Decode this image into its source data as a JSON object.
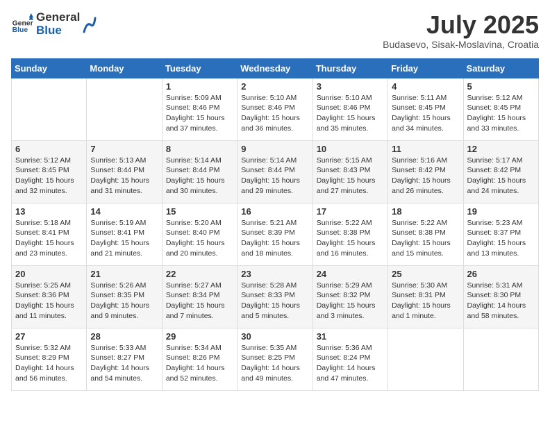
{
  "header": {
    "logo_general": "General",
    "logo_blue": "Blue",
    "month_year": "July 2025",
    "location": "Budasevo, Sisak-Moslavina, Croatia"
  },
  "weekdays": [
    "Sunday",
    "Monday",
    "Tuesday",
    "Wednesday",
    "Thursday",
    "Friday",
    "Saturday"
  ],
  "weeks": [
    [
      {
        "day": "",
        "sunrise": "",
        "sunset": "",
        "daylight": ""
      },
      {
        "day": "",
        "sunrise": "",
        "sunset": "",
        "daylight": ""
      },
      {
        "day": "1",
        "sunrise": "Sunrise: 5:09 AM",
        "sunset": "Sunset: 8:46 PM",
        "daylight": "Daylight: 15 hours and 37 minutes."
      },
      {
        "day": "2",
        "sunrise": "Sunrise: 5:10 AM",
        "sunset": "Sunset: 8:46 PM",
        "daylight": "Daylight: 15 hours and 36 minutes."
      },
      {
        "day": "3",
        "sunrise": "Sunrise: 5:10 AM",
        "sunset": "Sunset: 8:46 PM",
        "daylight": "Daylight: 15 hours and 35 minutes."
      },
      {
        "day": "4",
        "sunrise": "Sunrise: 5:11 AM",
        "sunset": "Sunset: 8:45 PM",
        "daylight": "Daylight: 15 hours and 34 minutes."
      },
      {
        "day": "5",
        "sunrise": "Sunrise: 5:12 AM",
        "sunset": "Sunset: 8:45 PM",
        "daylight": "Daylight: 15 hours and 33 minutes."
      }
    ],
    [
      {
        "day": "6",
        "sunrise": "Sunrise: 5:12 AM",
        "sunset": "Sunset: 8:45 PM",
        "daylight": "Daylight: 15 hours and 32 minutes."
      },
      {
        "day": "7",
        "sunrise": "Sunrise: 5:13 AM",
        "sunset": "Sunset: 8:44 PM",
        "daylight": "Daylight: 15 hours and 31 minutes."
      },
      {
        "day": "8",
        "sunrise": "Sunrise: 5:14 AM",
        "sunset": "Sunset: 8:44 PM",
        "daylight": "Daylight: 15 hours and 30 minutes."
      },
      {
        "day": "9",
        "sunrise": "Sunrise: 5:14 AM",
        "sunset": "Sunset: 8:44 PM",
        "daylight": "Daylight: 15 hours and 29 minutes."
      },
      {
        "day": "10",
        "sunrise": "Sunrise: 5:15 AM",
        "sunset": "Sunset: 8:43 PM",
        "daylight": "Daylight: 15 hours and 27 minutes."
      },
      {
        "day": "11",
        "sunrise": "Sunrise: 5:16 AM",
        "sunset": "Sunset: 8:42 PM",
        "daylight": "Daylight: 15 hours and 26 minutes."
      },
      {
        "day": "12",
        "sunrise": "Sunrise: 5:17 AM",
        "sunset": "Sunset: 8:42 PM",
        "daylight": "Daylight: 15 hours and 24 minutes."
      }
    ],
    [
      {
        "day": "13",
        "sunrise": "Sunrise: 5:18 AM",
        "sunset": "Sunset: 8:41 PM",
        "daylight": "Daylight: 15 hours and 23 minutes."
      },
      {
        "day": "14",
        "sunrise": "Sunrise: 5:19 AM",
        "sunset": "Sunset: 8:41 PM",
        "daylight": "Daylight: 15 hours and 21 minutes."
      },
      {
        "day": "15",
        "sunrise": "Sunrise: 5:20 AM",
        "sunset": "Sunset: 8:40 PM",
        "daylight": "Daylight: 15 hours and 20 minutes."
      },
      {
        "day": "16",
        "sunrise": "Sunrise: 5:21 AM",
        "sunset": "Sunset: 8:39 PM",
        "daylight": "Daylight: 15 hours and 18 minutes."
      },
      {
        "day": "17",
        "sunrise": "Sunrise: 5:22 AM",
        "sunset": "Sunset: 8:38 PM",
        "daylight": "Daylight: 15 hours and 16 minutes."
      },
      {
        "day": "18",
        "sunrise": "Sunrise: 5:22 AM",
        "sunset": "Sunset: 8:38 PM",
        "daylight": "Daylight: 15 hours and 15 minutes."
      },
      {
        "day": "19",
        "sunrise": "Sunrise: 5:23 AM",
        "sunset": "Sunset: 8:37 PM",
        "daylight": "Daylight: 15 hours and 13 minutes."
      }
    ],
    [
      {
        "day": "20",
        "sunrise": "Sunrise: 5:25 AM",
        "sunset": "Sunset: 8:36 PM",
        "daylight": "Daylight: 15 hours and 11 minutes."
      },
      {
        "day": "21",
        "sunrise": "Sunrise: 5:26 AM",
        "sunset": "Sunset: 8:35 PM",
        "daylight": "Daylight: 15 hours and 9 minutes."
      },
      {
        "day": "22",
        "sunrise": "Sunrise: 5:27 AM",
        "sunset": "Sunset: 8:34 PM",
        "daylight": "Daylight: 15 hours and 7 minutes."
      },
      {
        "day": "23",
        "sunrise": "Sunrise: 5:28 AM",
        "sunset": "Sunset: 8:33 PM",
        "daylight": "Daylight: 15 hours and 5 minutes."
      },
      {
        "day": "24",
        "sunrise": "Sunrise: 5:29 AM",
        "sunset": "Sunset: 8:32 PM",
        "daylight": "Daylight: 15 hours and 3 minutes."
      },
      {
        "day": "25",
        "sunrise": "Sunrise: 5:30 AM",
        "sunset": "Sunset: 8:31 PM",
        "daylight": "Daylight: 15 hours and 1 minute."
      },
      {
        "day": "26",
        "sunrise": "Sunrise: 5:31 AM",
        "sunset": "Sunset: 8:30 PM",
        "daylight": "Daylight: 14 hours and 58 minutes."
      }
    ],
    [
      {
        "day": "27",
        "sunrise": "Sunrise: 5:32 AM",
        "sunset": "Sunset: 8:29 PM",
        "daylight": "Daylight: 14 hours and 56 minutes."
      },
      {
        "day": "28",
        "sunrise": "Sunrise: 5:33 AM",
        "sunset": "Sunset: 8:27 PM",
        "daylight": "Daylight: 14 hours and 54 minutes."
      },
      {
        "day": "29",
        "sunrise": "Sunrise: 5:34 AM",
        "sunset": "Sunset: 8:26 PM",
        "daylight": "Daylight: 14 hours and 52 minutes."
      },
      {
        "day": "30",
        "sunrise": "Sunrise: 5:35 AM",
        "sunset": "Sunset: 8:25 PM",
        "daylight": "Daylight: 14 hours and 49 minutes."
      },
      {
        "day": "31",
        "sunrise": "Sunrise: 5:36 AM",
        "sunset": "Sunset: 8:24 PM",
        "daylight": "Daylight: 14 hours and 47 minutes."
      },
      {
        "day": "",
        "sunrise": "",
        "sunset": "",
        "daylight": ""
      },
      {
        "day": "",
        "sunrise": "",
        "sunset": "",
        "daylight": ""
      }
    ]
  ]
}
